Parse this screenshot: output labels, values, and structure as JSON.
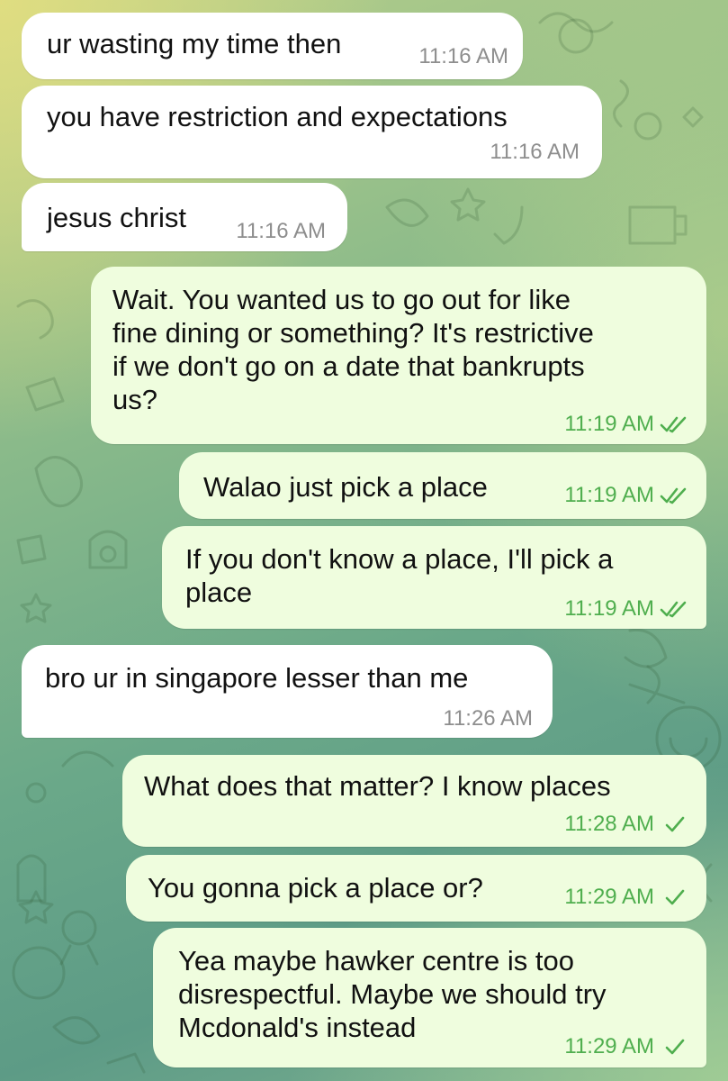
{
  "messages": [
    {
      "text": "ur wasting my time then",
      "time": "11:16 AM"
    },
    {
      "text": "you have restriction and expectations",
      "time": "11:16 AM"
    },
    {
      "text": "jesus christ",
      "time": "11:16 AM"
    },
    {
      "text": "Wait. You wanted us to go out for like\nfine dining or something? It's restrictive\nif we don't go on a date that bankrupts\nus?",
      "time": "11:19 AM",
      "status": "read"
    },
    {
      "text": "Walao just pick a place",
      "time": "11:19 AM",
      "status": "read"
    },
    {
      "text": "If you don't know a place, I'll pick a\nplace",
      "time": "11:19 AM",
      "status": "read"
    },
    {
      "text": "bro ur in singapore lesser than me",
      "time": "11:26 AM"
    },
    {
      "text": "What does that matter? I know places",
      "time": "11:28 AM",
      "status": "sent"
    },
    {
      "text": "You gonna pick a place or?",
      "time": "11:29 AM",
      "status": "sent"
    },
    {
      "text": "Yea maybe hawker centre is too\ndisrespectful. Maybe we should try\nMcdonald's instead",
      "time": "11:29 AM",
      "status": "sent"
    }
  ],
  "colors": {
    "incoming_bubble": "#ffffff",
    "outgoing_bubble": "#effdde",
    "outgoing_meta": "#4fae4e",
    "incoming_meta": "#8e8e8e"
  },
  "icons": {
    "read": "double-check-icon",
    "sent": "single-check-icon"
  }
}
